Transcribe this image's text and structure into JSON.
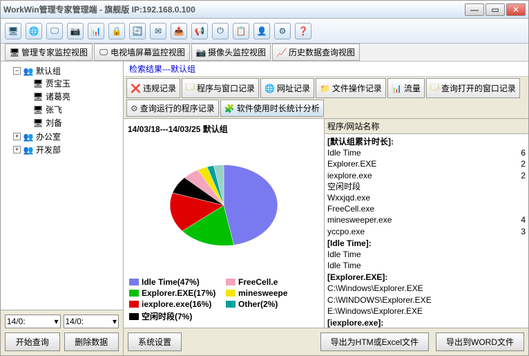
{
  "window": {
    "title": "WorkWin管理专家管理端 - 旗舰版 IP:192.168.0.100"
  },
  "viewtabs": [
    {
      "label": "管理专家监控视图"
    },
    {
      "label": "电视墙屏幕监控视图"
    },
    {
      "label": "摄像头监控视图"
    },
    {
      "label": "历史数据查询视图"
    }
  ],
  "tree": {
    "root": [
      {
        "label": "默认组",
        "expanded": true,
        "icon": "group",
        "children": [
          {
            "label": "贾宝玉",
            "icon": "pc"
          },
          {
            "label": "诸葛亮",
            "icon": "pc"
          },
          {
            "label": "张飞",
            "icon": "pc"
          },
          {
            "label": "刘备",
            "icon": "pc"
          }
        ]
      },
      {
        "label": "办公室",
        "expanded": false,
        "icon": "group"
      },
      {
        "label": "开发部",
        "expanded": false,
        "icon": "group"
      }
    ]
  },
  "daterange": {
    "from": "14/0:",
    "to": "14/0:"
  },
  "buttons": {
    "query": "开始查询",
    "delete": "删除数据",
    "settings": "系统设置",
    "exportExcel": "导出为HTM或Excel文件",
    "exportWord": "导出到WORD文件"
  },
  "searchResult": "检索结果---默认组",
  "recordTabs": {
    "row1": [
      {
        "label": "违规记录",
        "ic": "❌",
        "color": "#d00"
      },
      {
        "label": "程序与窗口记录",
        "ic": "🗔",
        "color": "#b80"
      },
      {
        "label": "网址记录",
        "ic": "🌐",
        "color": "#07a"
      },
      {
        "label": "文件操作记录",
        "ic": "📁",
        "color": "#a60"
      },
      {
        "label": "流量",
        "ic": "📊",
        "color": "#393"
      }
    ],
    "row2": [
      {
        "label": "查询打开的窗口记录",
        "ic": "🗔",
        "color": "#b80"
      },
      {
        "label": "查询运行的程序记录",
        "ic": "⚙",
        "color": "#555"
      },
      {
        "label": "软件使用时长统计分析",
        "ic": "🧩",
        "color": "#2a2",
        "active": true
      }
    ]
  },
  "chart_data": {
    "type": "pie",
    "title": "14/03/18---14/03/25  默认组",
    "series": [
      {
        "name": "Idle Time",
        "value": 47,
        "color": "#7a7af0"
      },
      {
        "name": "Explorer.EXE",
        "value": 17,
        "color": "#00c000"
      },
      {
        "name": "iexplore.exe",
        "value": 16,
        "color": "#e00000"
      },
      {
        "name": "空闲时段",
        "value": 7,
        "color": "#000000"
      },
      {
        "name": "FreeCell.exe",
        "value": 5,
        "color": "#f4a6bd"
      },
      {
        "name": "minesweeper.exe",
        "value": 3,
        "color": "#f5e600"
      },
      {
        "name": "Other",
        "value": 2,
        "color": "#00a0a0"
      },
      {
        "name": "_rest",
        "value": 3,
        "color": "#9ad2c6"
      }
    ],
    "legend": [
      {
        "label": "Idle Time(47%)",
        "color": "#7a7af0"
      },
      {
        "label": "FreeCell.e",
        "color": "#f4a6bd"
      },
      {
        "label": "Explorer.EXE(17%)",
        "color": "#00c000"
      },
      {
        "label": "minesweepe",
        "color": "#f5e600"
      },
      {
        "label": "iexplore.exe(16%)",
        "color": "#e00000"
      },
      {
        "label": "Other(2%)",
        "color": "#00a0a0"
      },
      {
        "label": "空闲时段(7%)",
        "color": "#000000"
      }
    ]
  },
  "detail": {
    "header": "程序/网站名称",
    "groups": [
      {
        "title": "[默认组累计时长]:",
        "items": [
          {
            "name": "Idle Time",
            "val": "6"
          },
          {
            "name": "Explorer.EXE",
            "val": "2"
          },
          {
            "name": "iexplore.exe",
            "val": "2"
          },
          {
            "name": "空闲时段",
            "val": ""
          },
          {
            "name": "Wxxjqd.exe",
            "val": ""
          },
          {
            "name": "FreeCell.exe",
            "val": ""
          },
          {
            "name": "minesweeper.exe",
            "val": "4"
          },
          {
            "name": "yccpo.exe",
            "val": "3"
          }
        ]
      },
      {
        "title": "[Idle Time]:",
        "items": [
          {
            "name": "Idle Time",
            "val": ""
          },
          {
            "name": "Idle Time",
            "val": ""
          }
        ]
      },
      {
        "title": "[Explorer.EXE]:",
        "items": [
          {
            "name": "C:\\Windows\\Explorer.EXE",
            "val": ""
          },
          {
            "name": "C:\\WINDOWS\\Explorer.EXE",
            "val": ""
          },
          {
            "name": "E:\\Windows\\Explorer.EXE",
            "val": ""
          }
        ]
      },
      {
        "title": "[iexplore.exe]:",
        "items": []
      }
    ]
  }
}
